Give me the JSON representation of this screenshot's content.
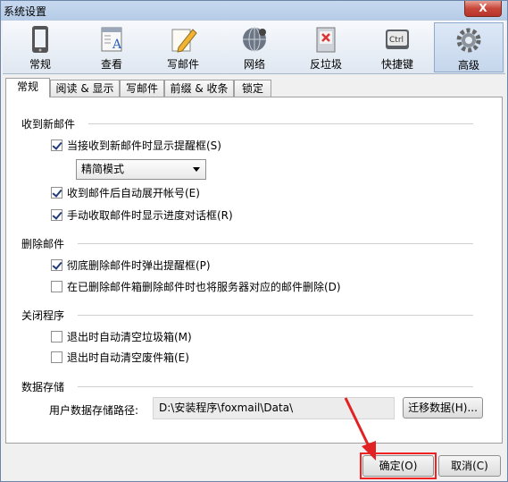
{
  "window": {
    "title": "系统设置",
    "close_label": "X"
  },
  "toolbar": {
    "items": [
      {
        "label": "常规",
        "icon": "phone-icon"
      },
      {
        "label": "查看",
        "icon": "view-icon"
      },
      {
        "label": "写邮件",
        "icon": "pencil-icon"
      },
      {
        "label": "网络",
        "icon": "network-icon"
      },
      {
        "label": "反垃圾",
        "icon": "spam-icon"
      },
      {
        "label": "快捷键",
        "icon": "keyboard-icon"
      },
      {
        "label": "高级",
        "icon": "gear-icon"
      }
    ],
    "active": "高级"
  },
  "tabs": [
    {
      "label": "常规"
    },
    {
      "label": "阅读 & 显示"
    },
    {
      "label": "写邮件"
    },
    {
      "label": "前缀 & 收条"
    },
    {
      "label": "锁定"
    }
  ],
  "groups": {
    "receive": {
      "title": "收到新邮件",
      "show_popup": {
        "label": "当接收到新邮件时显示提醒框(S)",
        "checked": true
      },
      "mode_select": {
        "value": "精简模式"
      },
      "expand_account": {
        "label": "收到邮件后自动展开帐号(E)",
        "checked": true
      },
      "show_progress": {
        "label": "手动收取邮件时显示进度对话框(R)",
        "checked": true
      }
    },
    "delete": {
      "title": "删除邮件",
      "confirm_delete": {
        "label": "彻底删除邮件时弹出提醒框(P)",
        "checked": true
      },
      "delete_server": {
        "label": "在已删除邮件箱删除邮件时也将服务器对应的邮件删除(D)",
        "checked": false
      }
    },
    "close": {
      "title": "关闭程序",
      "clear_junk": {
        "label": "退出时自动清空垃圾箱(M)",
        "checked": false
      },
      "clear_trash": {
        "label": "退出时自动清空废件箱(E)",
        "checked": false
      }
    },
    "storage": {
      "title": "数据存储",
      "path_label": "用户数据存储路径:",
      "path_value": "D:\\安装程序\\foxmail\\Data\\",
      "migrate_button": "迁移数据(H)..."
    }
  },
  "footer": {
    "ok_label": "确定(O)",
    "cancel_label": "取消(C)"
  },
  "colors": {
    "annotation_red": "#e22222",
    "accent": "#1e3c7a"
  }
}
